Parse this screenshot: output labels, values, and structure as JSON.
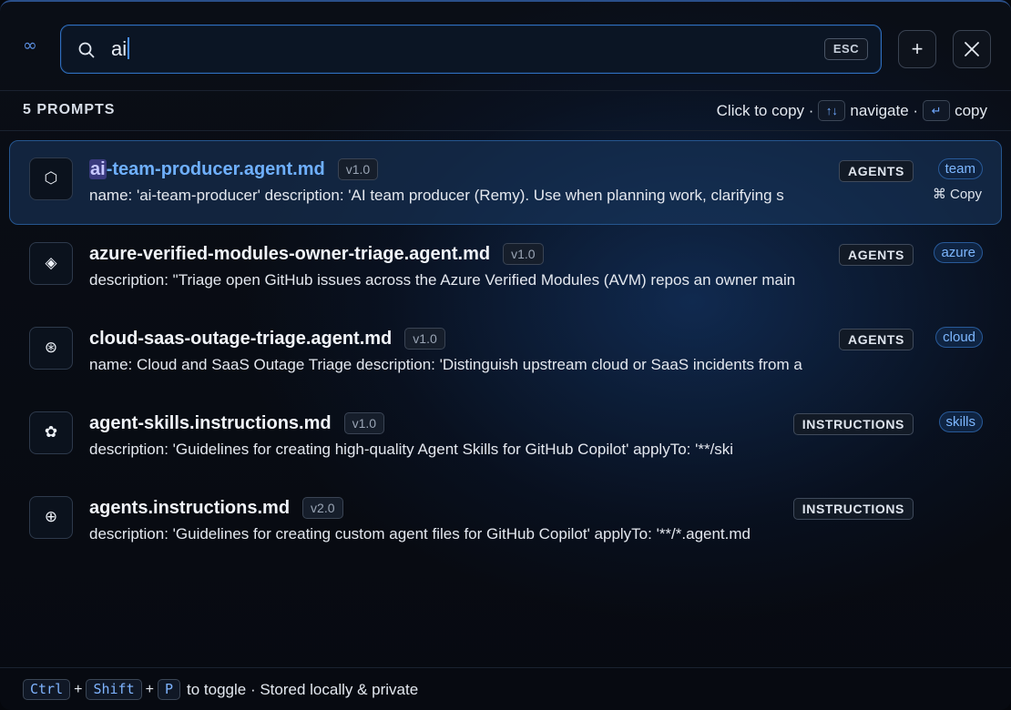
{
  "header": {
    "logo_glyph": "∞",
    "search_value": "ai",
    "esc_label": "ESC",
    "add_glyph": "+",
    "close_glyph": "✕"
  },
  "subheader": {
    "count": "5 PROMPTS",
    "hint_click": "Click to copy ·",
    "nav_key": "↑↓",
    "hint_navigate": "navigate ·",
    "copy_key": "↵",
    "hint_copy": "copy"
  },
  "prompts": [
    {
      "icon": "⬡",
      "title_match": "ai",
      "title_rest": "-team-producer.agent.md",
      "version": "v1.0",
      "description": "name: 'ai-team-producer' description: 'AI team producer (Remy). Use when planning work, clarifying s",
      "category": "AGENTS",
      "tag": "team",
      "copy_hint": "⌘ Copy"
    },
    {
      "icon": "◈",
      "title": "azure-verified-modules-owner-triage.agent.md",
      "version": "v1.0",
      "description": "description: \"Triage open GitHub issues across the Azure Verified Modules (AVM) repos an owner main",
      "category": "AGENTS",
      "tag": "azure"
    },
    {
      "icon": "⊛",
      "title": "cloud-saas-outage-triage.agent.md",
      "version": "v1.0",
      "description": "name: Cloud and SaaS Outage Triage description: 'Distinguish upstream cloud or SaaS incidents from a",
      "category": "AGENTS",
      "tag": "cloud"
    },
    {
      "icon": "✿",
      "title": "agent-skills.instructions.md",
      "version": "v1.0",
      "description": "description: 'Guidelines for creating high-quality Agent Skills for GitHub Copilot' applyTo: '**/ski",
      "category": "INSTRUCTIONS",
      "tag": "skills"
    },
    {
      "icon": "⊕",
      "title": "agents.instructions.md",
      "version": "v2.0",
      "description": "description: 'Guidelines for creating custom agent files for GitHub Copilot' applyTo: '**/*.agent.md",
      "category": "INSTRUCTIONS"
    }
  ],
  "footer": {
    "key1": "Ctrl",
    "key2": "Shift",
    "key3": "P",
    "plus": "+",
    "text": "to toggle · Stored locally & private"
  },
  "colors": {
    "accent": "#2f6fc0",
    "selected_title": "#6fb0ff",
    "tag_text": "#7db7ff"
  }
}
